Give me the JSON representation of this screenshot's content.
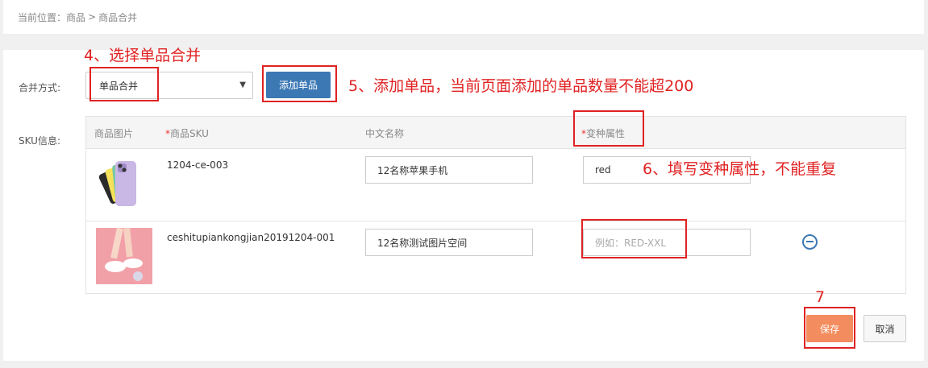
{
  "breadcrumb": {
    "prefix": "当前位置：",
    "items": [
      "商品",
      "商品合并"
    ],
    "separator": ">"
  },
  "form": {
    "merge_label": "合并方式:",
    "merge_value": "单品合并",
    "add_button": "添加单品",
    "sku_label": "SKU信息:"
  },
  "table": {
    "headers": {
      "image": "商品图片",
      "sku_star": "*",
      "sku": "商品SKU",
      "cn_name": "中文名称",
      "variant_star": "*",
      "variant": "变种属性"
    },
    "rows": [
      {
        "sku": "1204-ce-003",
        "cn_name": "12名称苹果手机",
        "variant": "red",
        "variant_placeholder": ""
      },
      {
        "sku": "ceshitupiankongjian20191204-001",
        "cn_name": "12名称测试图片空间",
        "variant": "",
        "variant_placeholder": "例如：RED-XXL"
      }
    ]
  },
  "actions": {
    "save": "保存",
    "cancel": "取消"
  },
  "annotations": {
    "step4": "4、选择单品合并",
    "step5": "5、添加单品，当前页面添加的单品数量不能超200",
    "step6": "6、填写变种属性，不能重复",
    "step7": "7"
  },
  "colors": {
    "primary": "#3c78b4",
    "save": "#f38c5e",
    "annotation": "#e02222",
    "required": "#e33333"
  }
}
